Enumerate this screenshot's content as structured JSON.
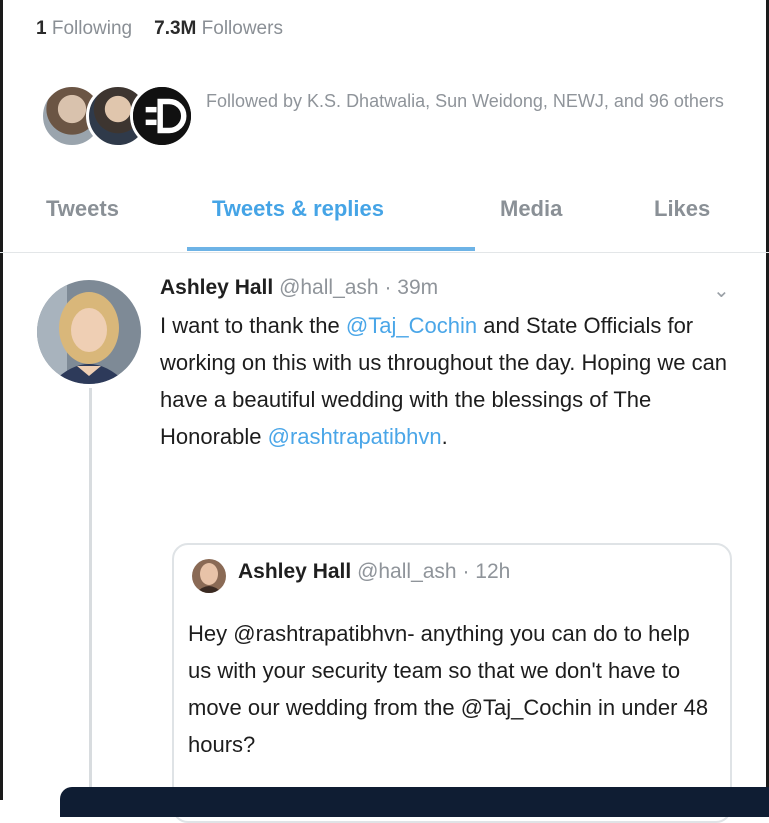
{
  "profile": {
    "following_count": "1",
    "following_label": "Following",
    "followers_count": "7.3M",
    "followers_label": "Followers",
    "followed_by_text": "Followed by K.S. Dhatwalia, Sun Weidong, NEWJ, and 96 others"
  },
  "tabs": [
    {
      "label": "Tweets"
    },
    {
      "label": "Tweets & replies",
      "active": true
    },
    {
      "label": "Media"
    },
    {
      "label": "Likes"
    }
  ],
  "tweet": {
    "name": "Ashley Hall",
    "meta": "@hall_ash · 39m",
    "text_1": "I want to thank the ",
    "mention_1": "@Taj_Cochin",
    "text_2": " and State Officials for working on this with us throughout the day. Hoping we can have a beautiful wedding with the blessings of The Honorable ",
    "mention_2": "@rashtrapatibhvn",
    "text_3": "."
  },
  "quoted_tweet": {
    "name": "Ashley Hall",
    "meta": "@hall_ash · 12h",
    "text": "Hey @rashtrapatibhvn- anything you can do to help us with your security team so that we don't have to move our wedding from the @Taj_Cochin in under 48 hours?"
  },
  "icons": {
    "tweet_menu": "chevron-down-icon"
  },
  "colors": {
    "accent": "#45a4e6",
    "muted_text": "#8f949a",
    "border": "#dfe3e6"
  }
}
